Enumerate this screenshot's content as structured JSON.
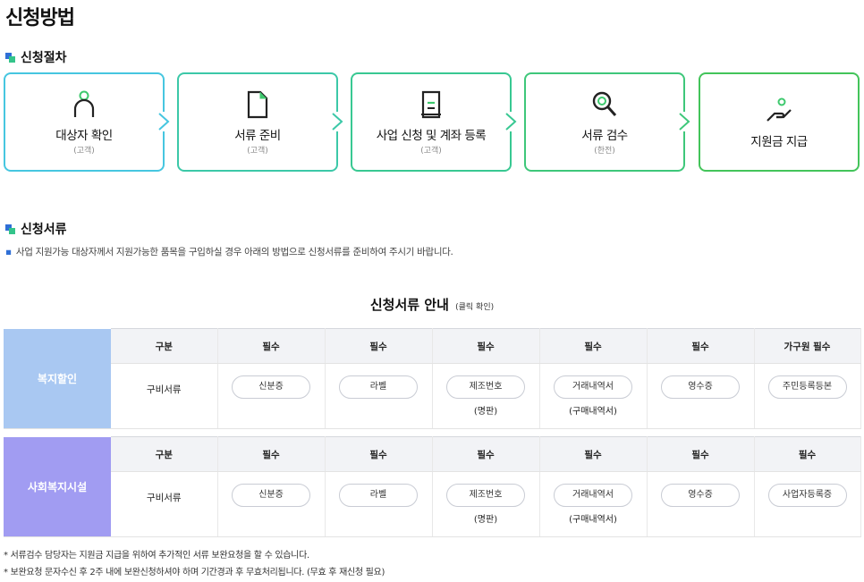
{
  "page": {
    "title": "신청방법"
  },
  "procedure": {
    "heading": "신청절차",
    "steps": [
      {
        "label": "대상자 확인",
        "sub": "(고객)",
        "icon": "person-icon",
        "color": "#46c6e0"
      },
      {
        "label": "서류 준비",
        "sub": "(고객)",
        "icon": "document-icon",
        "color": "#3cc8a8"
      },
      {
        "label": "사업 신청 및 계좌 등록",
        "sub": "(고객)",
        "icon": "list-document-icon",
        "color": "#38c892"
      },
      {
        "label": "서류 검수",
        "sub": "(한전)",
        "icon": "magnifier-icon",
        "color": "#3ec77a"
      },
      {
        "label": "지원금 지급",
        "sub": "",
        "icon": "hand-coin-icon",
        "color": "#43c45a"
      }
    ]
  },
  "documents": {
    "heading": "신청서류",
    "note": "사업 지원가능 대상자께서 지원가능한 품목을 구입하실 경우 아래의 방법으로 신청서류를 준비하여 주시기 바랍니다.",
    "table_title": "신청서류 안내",
    "table_title_small": "(클릭 확인)",
    "tables": [
      {
        "band": "복지할인",
        "band_color": "#a9c8f2",
        "headers": [
          "구분",
          "필수",
          "필수",
          "필수",
          "필수",
          "필수",
          "가구원 필수"
        ],
        "kind": "구비서류",
        "items": [
          {
            "label": "신분증",
            "sub": ""
          },
          {
            "label": "라벨",
            "sub": ""
          },
          {
            "label": "제조번호",
            "sub": "(명판)"
          },
          {
            "label": "거래내역서",
            "sub": "(구매내역서)"
          },
          {
            "label": "영수증",
            "sub": ""
          },
          {
            "label": "주민등록등본",
            "sub": ""
          }
        ]
      },
      {
        "band": "사회복지시설",
        "band_color": "#a19cf2",
        "headers": [
          "구분",
          "필수",
          "필수",
          "필수",
          "필수",
          "필수",
          "필수"
        ],
        "kind": "구비서류",
        "items": [
          {
            "label": "신분증",
            "sub": ""
          },
          {
            "label": "라벨",
            "sub": ""
          },
          {
            "label": "제조번호",
            "sub": "(명판)"
          },
          {
            "label": "거래내역서",
            "sub": "(구매내역서)"
          },
          {
            "label": "영수증",
            "sub": ""
          },
          {
            "label": "사업자등록증",
            "sub": ""
          }
        ]
      }
    ]
  },
  "footnotes": [
    "* 서류검수 담당자는 지원금 지급을 위하여 추가적인 서류 보완요청을 할 수 있습니다.",
    "* 보완요청 문자수신 후 2주 내에 보완신청하셔야 하며 기간경과 후 무효처리됩니다. (무효 후 재신청 필요)"
  ]
}
